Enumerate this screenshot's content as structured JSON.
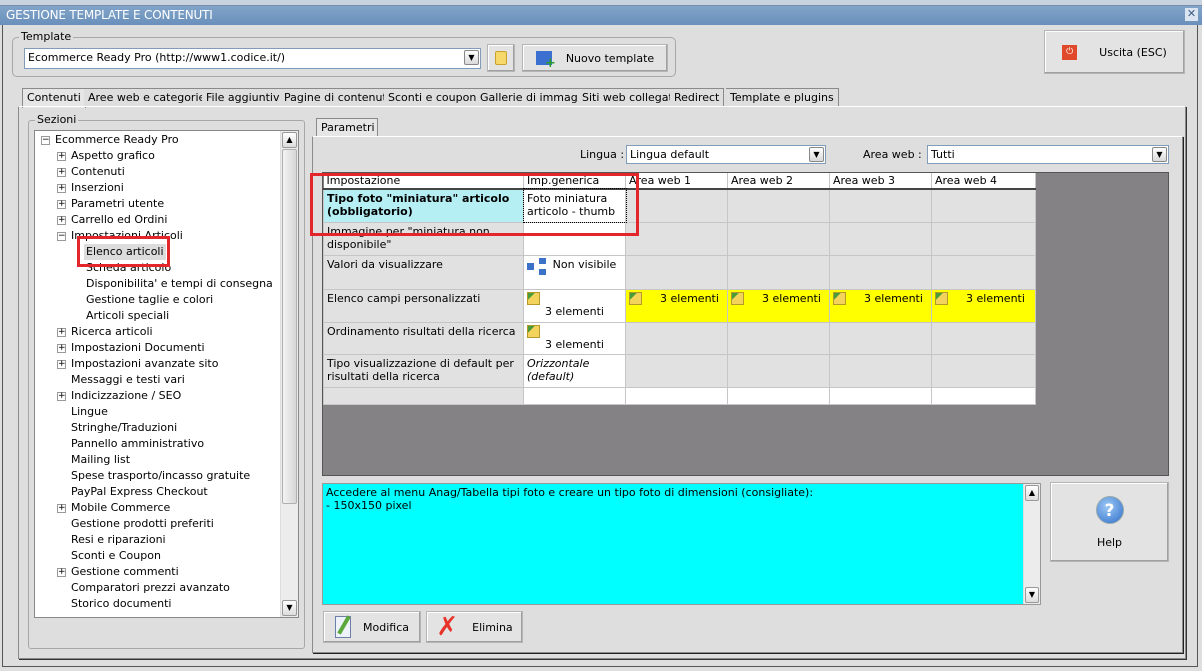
{
  "window": {
    "title": "GESTIONE TEMPLATE E CONTENUTI",
    "close": "✕"
  },
  "template": {
    "group_label": "Template",
    "value": "Ecommerce Ready Pro (http://www1.codice.it/)",
    "new_button": "Nuovo template",
    "exit_button": "Uscita (ESC)"
  },
  "tabs": [
    "Contenuti",
    "Aree web e categorie",
    "File aggiuntivi",
    "Pagine di contenuti",
    "Sconti e coupon",
    "Gallerie di immagini",
    "Siti web collegati",
    "Redirect",
    "Template e plugins"
  ],
  "sections": {
    "label": "Sezioni",
    "items": [
      {
        "label": "Ecommerce Ready Pro",
        "level": 0,
        "toggle": "−"
      },
      {
        "label": "Aspetto grafico",
        "level": 1,
        "toggle": "+"
      },
      {
        "label": "Contenuti",
        "level": 1,
        "toggle": "+"
      },
      {
        "label": "Inserzioni",
        "level": 1,
        "toggle": "+"
      },
      {
        "label": "Parametri utente",
        "level": 1,
        "toggle": "+"
      },
      {
        "label": "Carrello ed Ordini",
        "level": 1,
        "toggle": "+"
      },
      {
        "label": "Impostazioni Articoli",
        "level": 1,
        "toggle": "−"
      },
      {
        "label": "Elenco articoli",
        "level": 2,
        "toggle": "",
        "selected": true
      },
      {
        "label": "Scheda articolo",
        "level": 2,
        "toggle": ""
      },
      {
        "label": "Disponibilita' e tempi di consegna",
        "level": 2,
        "toggle": ""
      },
      {
        "label": "Gestione taglie e colori",
        "level": 2,
        "toggle": ""
      },
      {
        "label": "Articoli speciali",
        "level": 2,
        "toggle": ""
      },
      {
        "label": "Ricerca articoli",
        "level": 1,
        "toggle": "+"
      },
      {
        "label": "Impostazioni Documenti",
        "level": 1,
        "toggle": "+"
      },
      {
        "label": "Impostazioni avanzate sito",
        "level": 1,
        "toggle": "+"
      },
      {
        "label": "Messaggi e testi vari",
        "level": 1,
        "toggle": ""
      },
      {
        "label": "Indicizzazione / SEO",
        "level": 1,
        "toggle": "+"
      },
      {
        "label": "Lingue",
        "level": 1,
        "toggle": ""
      },
      {
        "label": "Stringhe/Traduzioni",
        "level": 1,
        "toggle": ""
      },
      {
        "label": "Pannello amministrativo",
        "level": 1,
        "toggle": ""
      },
      {
        "label": "Mailing list",
        "level": 1,
        "toggle": ""
      },
      {
        "label": "Spese trasporto/incasso gratuite",
        "level": 1,
        "toggle": ""
      },
      {
        "label": "PayPal Express Checkout",
        "level": 1,
        "toggle": ""
      },
      {
        "label": "Mobile Commerce",
        "level": 1,
        "toggle": "+"
      },
      {
        "label": "Gestione prodotti preferiti",
        "level": 1,
        "toggle": ""
      },
      {
        "label": "Resi e riparazioni",
        "level": 1,
        "toggle": ""
      },
      {
        "label": "Sconti e Coupon",
        "level": 1,
        "toggle": ""
      },
      {
        "label": "Gestione commenti",
        "level": 1,
        "toggle": "+"
      },
      {
        "label": "Comparatori prezzi avanzato",
        "level": 1,
        "toggle": ""
      },
      {
        "label": "Storico documenti",
        "level": 1,
        "toggle": ""
      }
    ]
  },
  "params": {
    "tab": "Parametri",
    "lingua_label": "Lingua :",
    "lingua_value": "Lingua default",
    "area_label": "Area web :",
    "area_value": "Tutti"
  },
  "grid": {
    "headers": [
      "Impostazione",
      "Imp.generica",
      "Area web 1",
      "Area web 2",
      "Area web 3",
      "Area web 4"
    ],
    "rows": [
      {
        "name": "Tipo foto \"miniatura\" articolo (obbligatorio)",
        "generic": "Foto miniatura articolo - thumb",
        "areas": [
          "",
          "",
          "",
          ""
        ],
        "bold": true
      },
      {
        "name": "Immagine per \"miniatura non disponibile\"",
        "generic": "",
        "areas": [
          "",
          "",
          "",
          ""
        ]
      },
      {
        "name": "Valori da visualizzare",
        "generic": "Non visibile",
        "icon": "tree",
        "areas": [
          "",
          "",
          "",
          ""
        ]
      },
      {
        "name": "Elenco campi personalizzati",
        "generic": "3 elementi",
        "icon": "folder",
        "areas": [
          "3 elementi",
          "3 elementi",
          "3 elementi",
          "3 elementi"
        ]
      },
      {
        "name": "Ordinamento risultati della ricerca",
        "generic": "3 elementi",
        "icon": "folder",
        "areas": [
          "",
          "",
          "",
          ""
        ]
      },
      {
        "name": "Tipo visualizzazione di default per risultati della ricerca",
        "generic": "Orizzontale (default)",
        "italic": true,
        "areas": [
          "",
          "",
          "",
          ""
        ]
      },
      {
        "name": "",
        "generic": "",
        "areas": [
          "",
          "",
          "",
          ""
        ]
      }
    ]
  },
  "description": {
    "line1": "Accedere al menu Anag/Tabella tipi foto e creare un tipo foto di dimensioni (consigliate):",
    "line2": "- 150x150 pixel"
  },
  "buttons": {
    "help": "Help",
    "modify": "Modifica",
    "delete": "Elimina"
  },
  "colors": {
    "highlight": "#e3262c",
    "description_bg": "#00ffff",
    "area_cell": "#ffff00",
    "selected_row": "#b5eff4"
  }
}
